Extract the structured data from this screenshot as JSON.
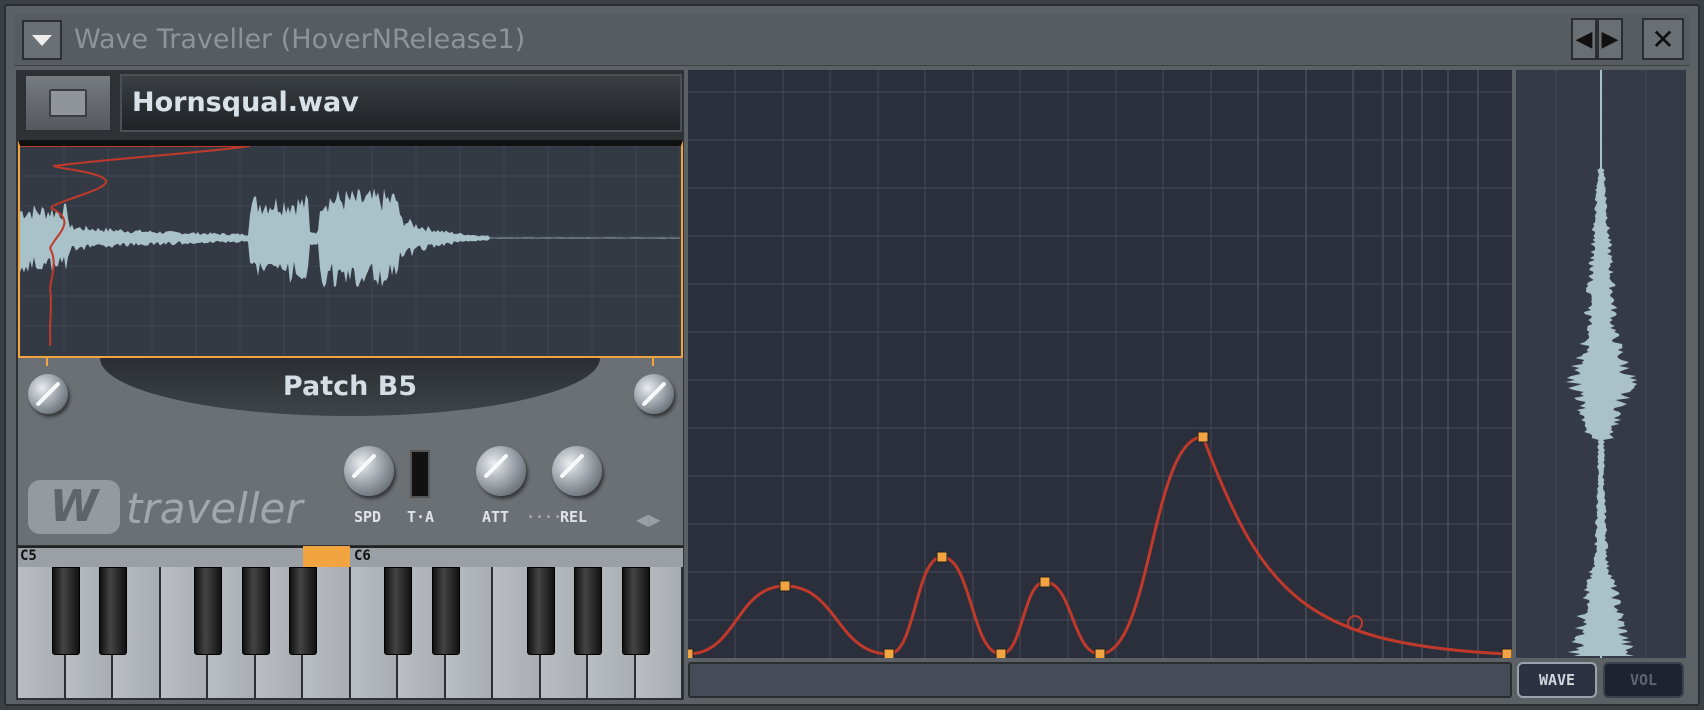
{
  "window": {
    "title": "Wave Traveller (HoverNRelease1)"
  },
  "icons": {
    "menu": "triangle-down-icon",
    "prev": "arrow-left-icon",
    "next": "arrow-right-icon",
    "close": "close-icon",
    "folder": "folder-icon"
  },
  "file": {
    "name": "Hornsqual.wav"
  },
  "patch": {
    "name": "Patch B5"
  },
  "controls": {
    "spd": "SPD",
    "ta": "T·A",
    "att": "ATT",
    "dots": "····",
    "rel": "REL"
  },
  "logo": {
    "mark": "W",
    "text": "traveller"
  },
  "keyboard": {
    "octave1": "C5",
    "octave2": "C6"
  },
  "view_buttons": {
    "wave": "WAVE",
    "vol": "VOL",
    "active": "WAVE"
  },
  "colors": {
    "accent": "#f2a440",
    "envelope": "#c0392b",
    "waveform": "#a9c1c8"
  }
}
